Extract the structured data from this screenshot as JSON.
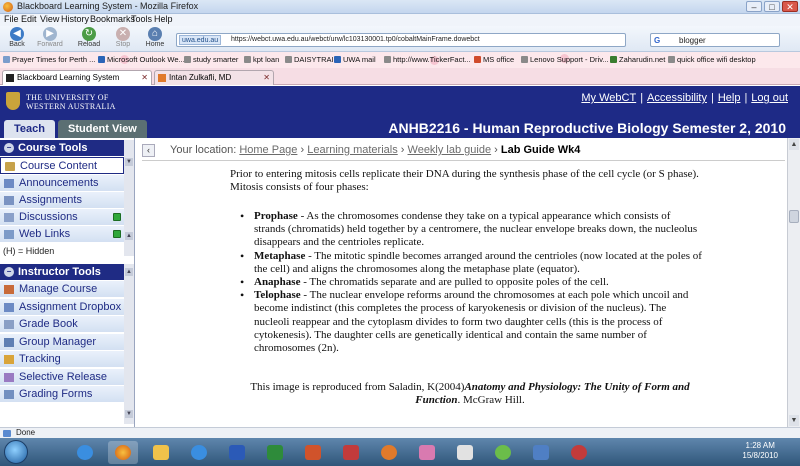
{
  "browser": {
    "window_title": "Blackboard Learning System - Mozilla Firefox",
    "menu": [
      "File",
      "Edit",
      "View",
      "History",
      "Bookmarks",
      "Tools",
      "Help"
    ],
    "nav": {
      "back": "Back",
      "forward": "Forward",
      "reload": "Reload",
      "stop": "Stop",
      "home": "Home"
    },
    "url_domain": "uwa.edu.au",
    "url": "https://webct.uwa.edu.au/webct/urw/lc103130001.tp0/cobaltMainFrame.dowebct",
    "search_query": "blogger",
    "bookmarks": [
      "Prayer Times for Perth ...",
      "Microsoft Outlook We...",
      "study smarter",
      "kpt loan",
      "DAISYTRAIL",
      "UWA mail",
      "http://www.TickerFact...",
      "MS office",
      "Lenovo Support - Driv...",
      "Zaharudin.net",
      "quick office wifi desktop"
    ],
    "tabs": [
      {
        "label": "Blackboard Learning System"
      },
      {
        "label": "Intan Zulkafli, MD"
      }
    ],
    "status": "Done"
  },
  "blackboard": {
    "university": [
      "THE UNIVERSITY OF",
      "WESTERN AUSTRALIA"
    ],
    "header_links": [
      "My WebCT",
      "Accessibility",
      "Help",
      "Log out"
    ],
    "tabs": [
      "Teach",
      "Student View"
    ],
    "course_title": "ANHB2216 - Human Reproductive Biology Semester 2, 2010"
  },
  "sidebar": {
    "course_tools_heading": "Course Tools",
    "course_tools": [
      "Course Content",
      "Announcements",
      "Assignments",
      "Discussions",
      "Web Links"
    ],
    "hidden_note": "(H) = Hidden",
    "instructor_tools_heading": "Instructor Tools",
    "instructor_tools": [
      "Manage Course",
      "Assignment Dropbox",
      "Grade Book",
      "Group Manager",
      "Tracking",
      "Selective Release",
      "Grading Forms"
    ]
  },
  "breadcrumb": {
    "label": "Your location:",
    "items": [
      "Home Page",
      "Learning materials",
      "Weekly lab guide"
    ],
    "current": "Lab Guide Wk4"
  },
  "content": {
    "intro": "Prior to entering mitosis cells replicate their DNA during the synthesis phase of the cell cycle (or S phase). Mitosis consists of four phases:",
    "phases": [
      {
        "name": "Prophase",
        "text": " - As the chromosomes condense they take on a typical appearance which consists of strands (chromatids) held together by a centromere, the nuclear envelope breaks down, the nucleolus disappears and the centrioles replicate."
      },
      {
        "name": "Metaphase",
        "text": " - The mitotic spindle becomes arranged around the centrioles (now located at the poles of the cell) and aligns the chromosomes along the metaphase plate (equator)."
      },
      {
        "name": "Anaphase",
        "text": " - The chromatids separate and are pulled to opposite poles of the cell."
      },
      {
        "name": "Telophase",
        "text": " - The nuclear envelope reforms around the chromosomes at each pole which uncoil and become indistinct (this completes the process of karyokenesis or division of the nucleus). The nucleoli reappear and the cytoplasm divides to form two daughter cells (this is the process of cytokenesis). The daughter cells are genetically identical and contain the same number of chromosomes (2n)."
      }
    ],
    "citation_prefix": "This image is reproduced from Saladin, K(2004)",
    "citation_title": "Anatomy and Physiology: The Unity of Form and Function",
    "citation_suffix": ". McGraw Hill."
  },
  "taskbar": {
    "time": "1:28 AM",
    "date": "15/8/2010"
  },
  "colors": {
    "bb_navy": "#1e2a86",
    "sidebar_green": "#2fa83a"
  }
}
